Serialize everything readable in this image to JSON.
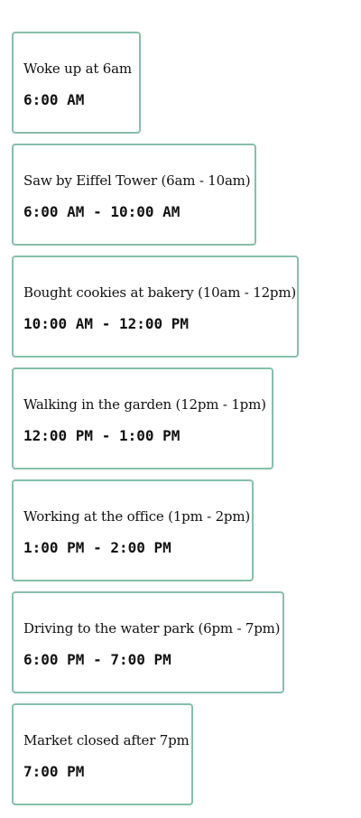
{
  "timeline": {
    "events": [
      {
        "title": "Woke up at 6am",
        "time": "6:00 AM"
      },
      {
        "title": "Saw by Eiffel Tower (6am - 10am)",
        "time": "6:00 AM - 10:00 AM"
      },
      {
        "title": "Bought cookies at bakery (10am - 12pm)",
        "time": "10:00 AM - 12:00 PM"
      },
      {
        "title": "Walking in the garden (12pm - 1pm)",
        "time": "12:00 PM - 1:00 PM"
      },
      {
        "title": "Working at the office (1pm - 2pm)",
        "time": "1:00 PM - 2:00 PM"
      },
      {
        "title": "Driving to the water park (6pm - 7pm)",
        "time": "6:00 PM - 7:00 PM"
      },
      {
        "title": "Market closed after 7pm",
        "time": "7:00 PM"
      }
    ]
  },
  "colors": {
    "card_border": "#86bfa8",
    "text": "#111111",
    "background": "#ffffff"
  }
}
